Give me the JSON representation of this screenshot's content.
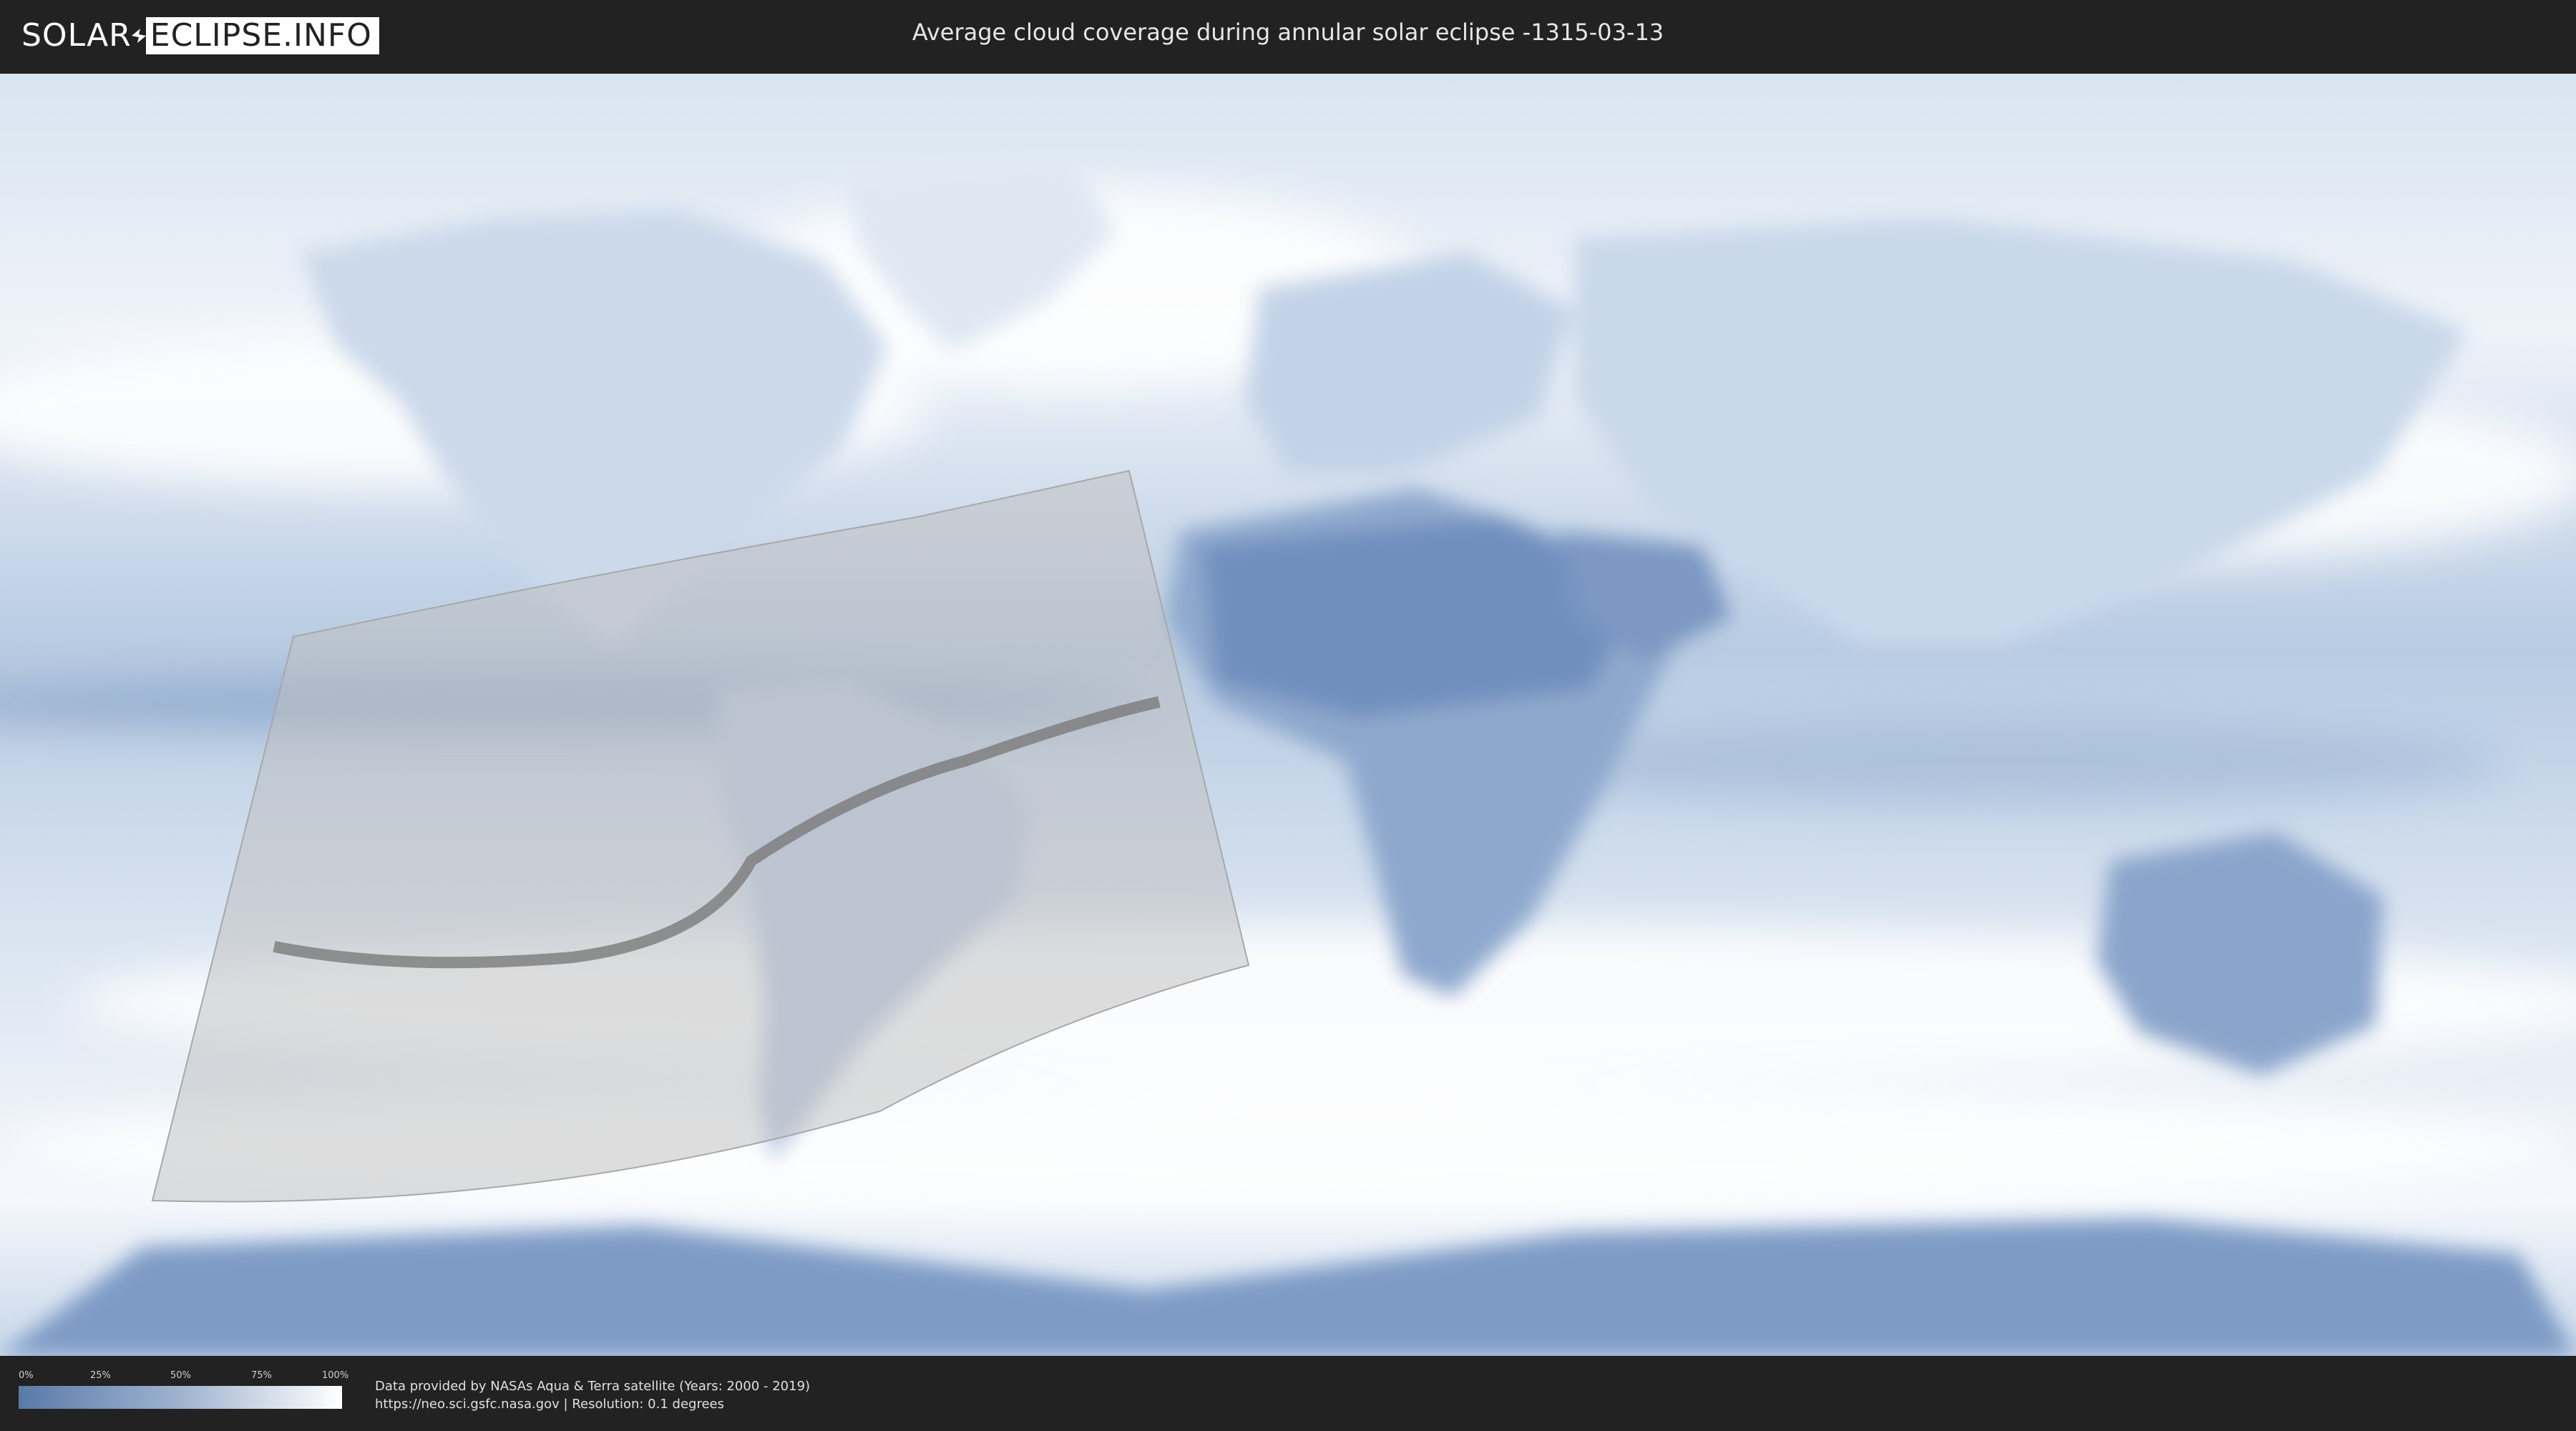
{
  "header": {
    "logo_left": "SOLAR",
    "logo_right": "ECLIPSE.INFO",
    "title": "Average cloud coverage during annular solar eclipse -1315-03-13"
  },
  "legend": {
    "ticks": [
      "0%",
      "25%",
      "50%",
      "75%",
      "100%"
    ],
    "colors": {
      "low": "#5a7aa8",
      "high": "#ffffff"
    }
  },
  "footer": {
    "credit_line1": "Data provided by NASAs Aqua & Terra satellite (Years: 2000 - 2019)",
    "credit_line2": "https://neo.sci.gsfc.nasa.gov | Resolution: 0.1 degrees"
  },
  "colors": {
    "background": "#222222",
    "cloud": "#eef3f9",
    "clear": "#6a8cbc",
    "eclipse_zone": "#bcbcbc",
    "central_line": "#777777"
  },
  "icons": [
    "solar-eclipse-logo-mark"
  ]
}
